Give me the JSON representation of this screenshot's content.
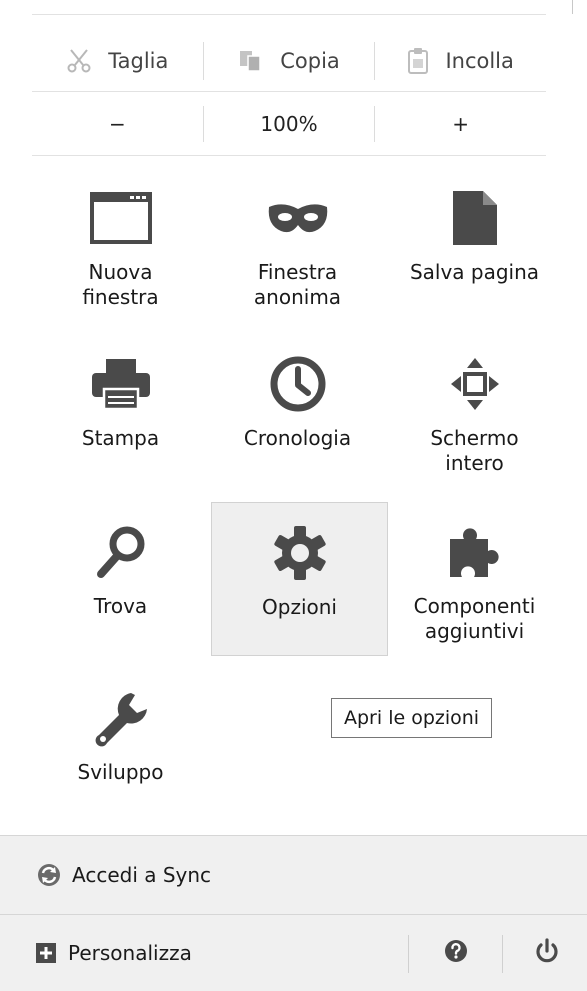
{
  "edit": {
    "cut_label": "Taglia",
    "copy_label": "Copia",
    "paste_label": "Incolla"
  },
  "zoom": {
    "minus_label": "−",
    "level": "100%",
    "plus_label": "+"
  },
  "tiles": [
    {
      "label": "Nuova\nfinestra",
      "icon": "new-window-icon"
    },
    {
      "label": "Finestra\nanonima",
      "icon": "private-mask-icon"
    },
    {
      "label": "Salva pagina",
      "icon": "save-page-icon"
    },
    {
      "label": "Stampa",
      "icon": "printer-icon"
    },
    {
      "label": "Cronologia",
      "icon": "history-clock-icon"
    },
    {
      "label": "Schermo\nintero",
      "icon": "fullscreen-icon"
    },
    {
      "label": "Trova",
      "icon": "search-icon"
    },
    {
      "label": "Opzioni",
      "icon": "gear-icon"
    },
    {
      "label": "Componenti\naggiuntivi",
      "icon": "puzzle-icon"
    },
    {
      "label": "Sviluppo",
      "icon": "wrench-icon"
    }
  ],
  "tooltip": "Apri le opzioni",
  "footer": {
    "sync_label": "Accedi a Sync",
    "customize_label": "Personalizza"
  },
  "colors": {
    "icon": "#4a4a4a",
    "active_tile_bg": "#efefef",
    "footer_bg": "#f0f0f0"
  }
}
